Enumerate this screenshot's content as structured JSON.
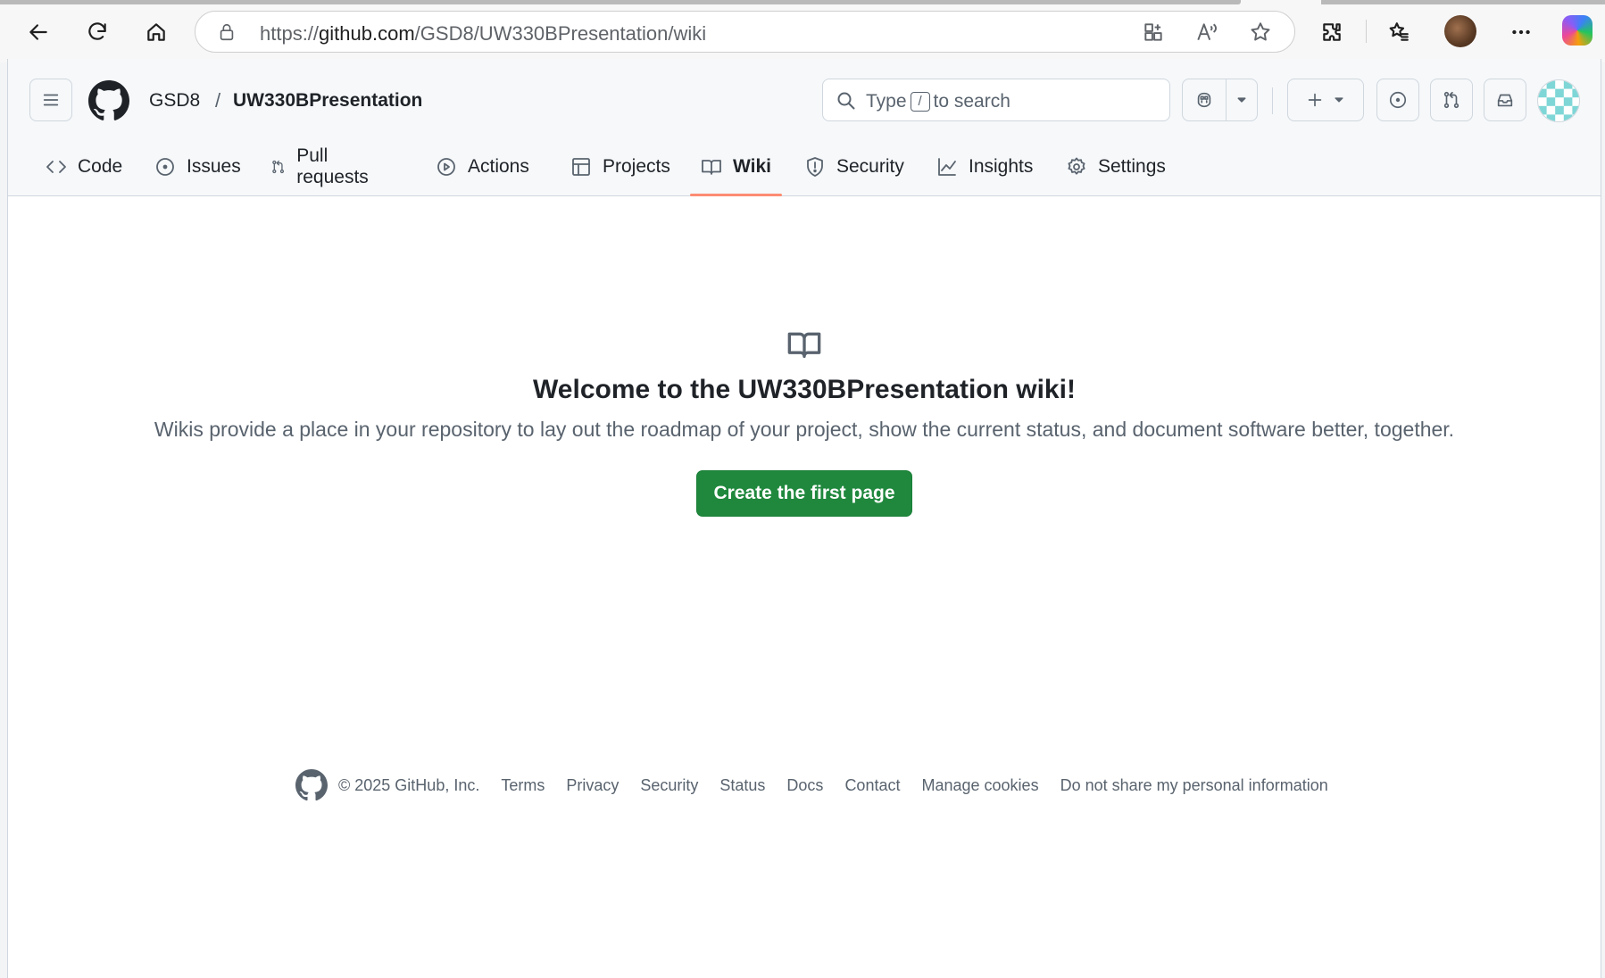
{
  "browser": {
    "url_prefix": "https://",
    "url_host": "github.com",
    "url_path": "/GSD8/UW330BPresentation/wiki"
  },
  "repo": {
    "owner": "GSD8",
    "separator": "/",
    "name": "UW330BPresentation"
  },
  "search": {
    "label_before": "Type",
    "shortcut": "/",
    "label_after": "to search"
  },
  "tabs": [
    {
      "label": "Code",
      "icon": "code-icon"
    },
    {
      "label": "Issues",
      "icon": "issue-icon"
    },
    {
      "label": "Pull requests",
      "icon": "pull-request-icon"
    },
    {
      "label": "Actions",
      "icon": "play-icon"
    },
    {
      "label": "Projects",
      "icon": "table-icon"
    },
    {
      "label": "Wiki",
      "icon": "book-icon",
      "active": true
    },
    {
      "label": "Security",
      "icon": "shield-icon"
    },
    {
      "label": "Insights",
      "icon": "graph-icon"
    },
    {
      "label": "Settings",
      "icon": "gear-icon"
    }
  ],
  "blankslate": {
    "title": "Welcome to the UW330BPresentation wiki!",
    "description": "Wikis provide a place in your repository to lay out the roadmap of your project, show the current status, and document software better, together.",
    "button": "Create the first page"
  },
  "footer": {
    "copyright": "© 2025 GitHub, Inc.",
    "links": [
      "Terms",
      "Privacy",
      "Security",
      "Status",
      "Docs",
      "Contact",
      "Manage cookies",
      "Do not share my personal information"
    ]
  },
  "colors": {
    "primary_button": "#1f883d",
    "active_tab_underline": "#fd8c73"
  }
}
